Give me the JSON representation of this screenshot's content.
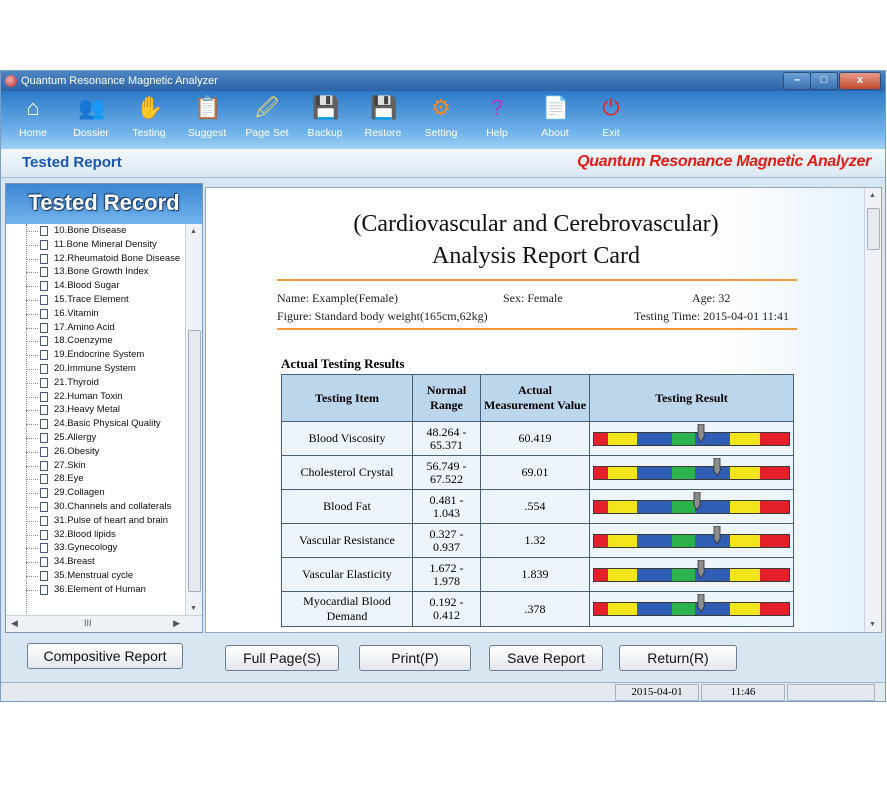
{
  "window": {
    "title": "Quantum Resonance Magnetic Analyzer",
    "min": "–",
    "max": "□",
    "close": "x"
  },
  "toolbar": [
    {
      "label": "Home",
      "icon": "⌂"
    },
    {
      "label": "Dossier",
      "icon": "👥"
    },
    {
      "label": "Testing",
      "icon": "✋"
    },
    {
      "label": "Suggest",
      "icon": "📋"
    },
    {
      "label": "Page Set",
      "icon": "🖉"
    },
    {
      "label": "Backup",
      "icon": "💾"
    },
    {
      "label": "Restore",
      "icon": "💾"
    },
    {
      "label": "Setting",
      "icon": "⚙"
    },
    {
      "label": "Help",
      "icon": "?"
    },
    {
      "label": "About",
      "icon": "📄"
    },
    {
      "label": "Exit",
      "icon": "⏻"
    }
  ],
  "header": {
    "section": "Tested Report",
    "brand": "Quantum Resonance Magnetic Analyzer"
  },
  "sidebar": {
    "title": "Tested Record",
    "items": [
      "10.Bone Disease",
      "11.Bone Mineral Density",
      "12.Rheumatoid Bone Disease",
      "13.Bone Growth Index",
      "14.Blood Sugar",
      "15.Trace Element",
      "16.Vitamin",
      "17.Amino Acid",
      "18.Coenzyme",
      "19.Endocrine System",
      "20.Immune System",
      "21.Thyroid",
      "22.Human Toxin",
      "23.Heavy Metal",
      "24.Basic Physical Quality",
      "25.Allergy",
      "26.Obesity",
      "27.Skin",
      "28.Eye",
      "29.Collagen",
      "30.Channels and collaterals",
      "31.Pulse of heart and brain",
      "32.Blood lipids",
      "33.Gynecology",
      "34.Breast",
      "35.Menstrual cycle",
      "36.Element of Human"
    ],
    "hscroll_mark": "III",
    "composite_button": "Compositive Report"
  },
  "report": {
    "title_line1": "(Cardiovascular and Cerebrovascular)",
    "title_line2": "Analysis Report Card",
    "name": "Name: Example(Female)",
    "sex": "Sex: Female",
    "age": "Age: 32",
    "figure": "Figure: Standard body weight(165cm,62kg)",
    "testing_time": "Testing Time: 2015-04-01 11:41",
    "section_title": "Actual Testing Results",
    "columns": [
      "Testing Item",
      "Normal Range",
      "Actual Measurement Value",
      "Testing Result"
    ],
    "rows": [
      {
        "item": "Blood Viscosity",
        "range_a": "48.264 -",
        "range_b": "65.371",
        "value": "60.419",
        "level": 0.55
      },
      {
        "item": "Cholesterol Crystal",
        "range_a": "56.749 -",
        "range_b": "67.522",
        "value": "69.01",
        "level": 0.63
      },
      {
        "item": "Blood Fat",
        "range_a": "0.481 -",
        "range_b": "1.043",
        "value": ".554",
        "level": 0.53
      },
      {
        "item": "Vascular Resistance",
        "range_a": "0.327 -",
        "range_b": "0.937",
        "value": "1.32",
        "level": 0.63
      },
      {
        "item": "Vascular Elasticity",
        "range_a": "1.672 -",
        "range_b": "1.978",
        "value": "1.839",
        "level": 0.55
      },
      {
        "item": "Myocardial Blood Demand",
        "range_a": "0.192 -",
        "range_b": "0.412",
        "value": ".378",
        "level": 0.55
      }
    ],
    "bar_colors": {
      "red": "#e3202a",
      "yellow": "#f2e51c",
      "blue": "#2f5fb5",
      "green": "#2bb24a",
      "pointer": "#8c8c8c"
    }
  },
  "buttons": {
    "full_page": "Full Page(S)",
    "print": "Print(P)",
    "save_report": "Save Report",
    "return": "Return(R)"
  },
  "status": {
    "date": "2015-04-01",
    "time": "11:46"
  }
}
